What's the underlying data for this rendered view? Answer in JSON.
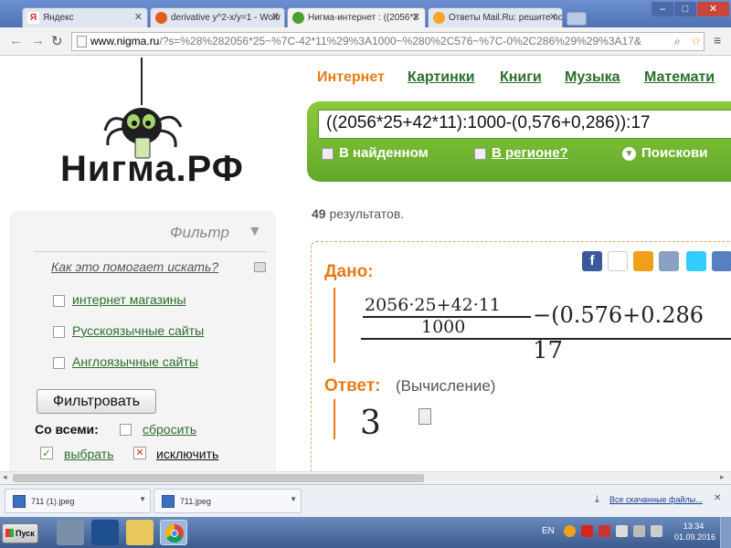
{
  "browser": {
    "tabs": [
      {
        "label": "Яндекс",
        "icon": "yandex-icon",
        "color": "#e01d1d"
      },
      {
        "label": "derivative y^2-x/y=1 - Wolfr",
        "icon": "wolfram-icon",
        "color": "#e85a18"
      },
      {
        "label": "Нигма-интернет : ((2056*2",
        "icon": "nigma-icon",
        "color": "#4aa02c"
      },
      {
        "label": "Ответы Mail.Ru: решите по",
        "icon": "mailru-icon",
        "color": "#f5a623"
      }
    ],
    "address": {
      "domain": "www.nigma.ru",
      "rest": "/?s=%28%282056*25~%7C-42*11%29%3A1000~%280%2C576~%7C-0%2C286%29%29%3A17&"
    }
  },
  "site": {
    "logo_text": "Нигма.РФ",
    "nav": [
      "Интернет",
      "Картинки",
      "Книги",
      "Музыка",
      "Математи"
    ],
    "search": {
      "query": "((2056*25+42*11):1000-(0,576+0,286)):17",
      "opt1": "В найденном",
      "opt2": "В регионе?",
      "opt3": "Поискови"
    },
    "results_count": "49",
    "results_label": "результатов."
  },
  "sidebar": {
    "title": "Фильтр",
    "help": "Как это помогает искать?",
    "items": [
      "интернет магазины",
      "Русскоязычные сайты",
      "Англоязычные сайты"
    ],
    "filter_button": "Фильтровать",
    "all_label": "Со всеми:",
    "reset": "сбросить",
    "select": "выбрать",
    "exclude": "исключить"
  },
  "answer": {
    "given_label": "Дано:",
    "expr_num": "2056·25+42·11",
    "expr_den": "1000",
    "expr_minus": "−(0.576+0.286",
    "expr_bottom": "17",
    "answer_label": "Ответ:",
    "answer_note": "(Вычисление)",
    "answer_value": "3"
  },
  "downloads": {
    "items": [
      "711 (1).jpeg",
      "711.jpeg"
    ],
    "all": "Все скачанные файлы..."
  },
  "taskbar": {
    "start": "Пуск",
    "lang": "EN",
    "time": "13:34",
    "date": "01.09.2016"
  }
}
